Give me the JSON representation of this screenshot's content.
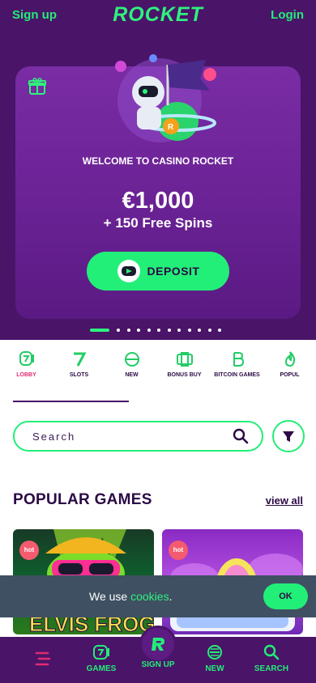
{
  "header": {
    "signup": "Sign up",
    "logo": "ROCKET",
    "login": "Login"
  },
  "promo": {
    "welcome": "WELCOME TO CASINO ROCKET",
    "amount": "€1,000",
    "spins": "+ 150 Free Spins",
    "deposit_label": "DEPOSIT",
    "slides_total": 12,
    "active_slide": 1
  },
  "categories": [
    {
      "label": "LOBBY",
      "icon": "lobby-icon",
      "active": true
    },
    {
      "label": "SLOTS",
      "icon": "slots-icon"
    },
    {
      "label": "NEW",
      "icon": "new-icon"
    },
    {
      "label": "BONUS BUY",
      "icon": "bonus-buy-icon"
    },
    {
      "label": "BITCOIN GAMES",
      "icon": "bitcoin-icon"
    },
    {
      "label": "POPUL",
      "icon": "popular-flame-icon"
    }
  ],
  "search": {
    "placeholder": "Search"
  },
  "popular": {
    "title": "POPULAR GAMES",
    "view_all": "view all",
    "games": [
      {
        "badge": "hot",
        "visible_title": "ELVIS FROG"
      },
      {
        "badge": "hot",
        "visible_title": ""
      }
    ]
  },
  "cookie": {
    "text_prefix": "We use ",
    "text_link": "cookies",
    "text_suffix": ".",
    "ok": "OK"
  },
  "bottom_nav": {
    "games": "GAMES",
    "signup": "SIGN UP",
    "new": "NEW",
    "search": "SEARCH"
  },
  "colors": {
    "brand_green": "#22ee77",
    "brand_purple": "#4a1469",
    "active_red": "#e02a6f"
  }
}
